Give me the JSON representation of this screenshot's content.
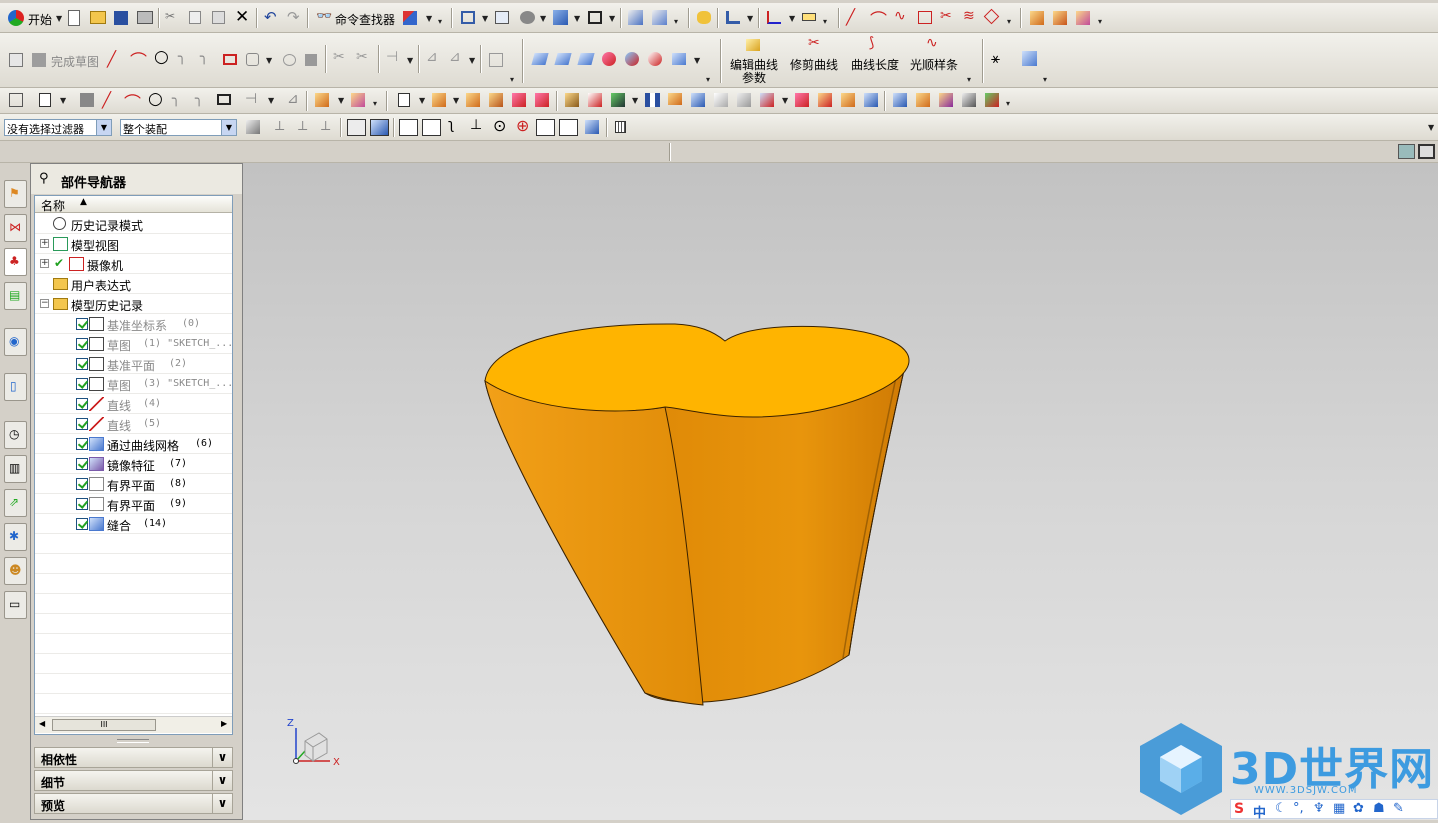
{
  "toolbar1": {
    "start_label": "开始",
    "cmd_finder_label": "命令查找器"
  },
  "toolbar2": {
    "finish_sketch_label": "完成草图",
    "edit_curve_label": "编辑曲线",
    "edit_curve_label2": "参数",
    "trim_curve_label": "修剪曲线",
    "curve_length_label": "曲线长度",
    "smooth_spline_label": "光顺样条"
  },
  "filter_bar": {
    "selection_filter": "没有选择过滤器",
    "scope": "整个装配"
  },
  "navigator": {
    "title": "部件导航器",
    "column_name": "名称",
    "rows": [
      {
        "label": "历史记录模式",
        "ref": ""
      },
      {
        "label": "模型视图",
        "ref": ""
      },
      {
        "label": "摄像机",
        "ref": ""
      },
      {
        "label": "用户表达式",
        "ref": ""
      },
      {
        "label": "模型历史记录",
        "ref": ""
      },
      {
        "label": "基准坐标系",
        "ref": "(0)"
      },
      {
        "label": "草图",
        "ref": "(1) \"SKETCH_..."
      },
      {
        "label": "基准平面",
        "ref": "(2)"
      },
      {
        "label": "草图",
        "ref": "(3) \"SKETCH_..."
      },
      {
        "label": "直线",
        "ref": "(4)"
      },
      {
        "label": "直线",
        "ref": "(5)"
      },
      {
        "label": "通过曲线网格",
        "ref": "(6)"
      },
      {
        "label": "镜像特征",
        "ref": "(7)"
      },
      {
        "label": "有界平面",
        "ref": "(8)"
      },
      {
        "label": "有界平面",
        "ref": "(9)"
      },
      {
        "label": "缝合",
        "ref": "(14)"
      }
    ],
    "scroll_thumb": "III",
    "sections": [
      {
        "label": "相依性"
      },
      {
        "label": "细节"
      },
      {
        "label": "预览"
      }
    ]
  },
  "viewport": {
    "axis_z": "Z",
    "axis_x": "X",
    "solid_color": "#e8960a",
    "top_color": "#ffb400"
  },
  "watermark": {
    "text": "3D世界网",
    "url": "WWW.3DSJW.COM",
    "ime": "中"
  }
}
